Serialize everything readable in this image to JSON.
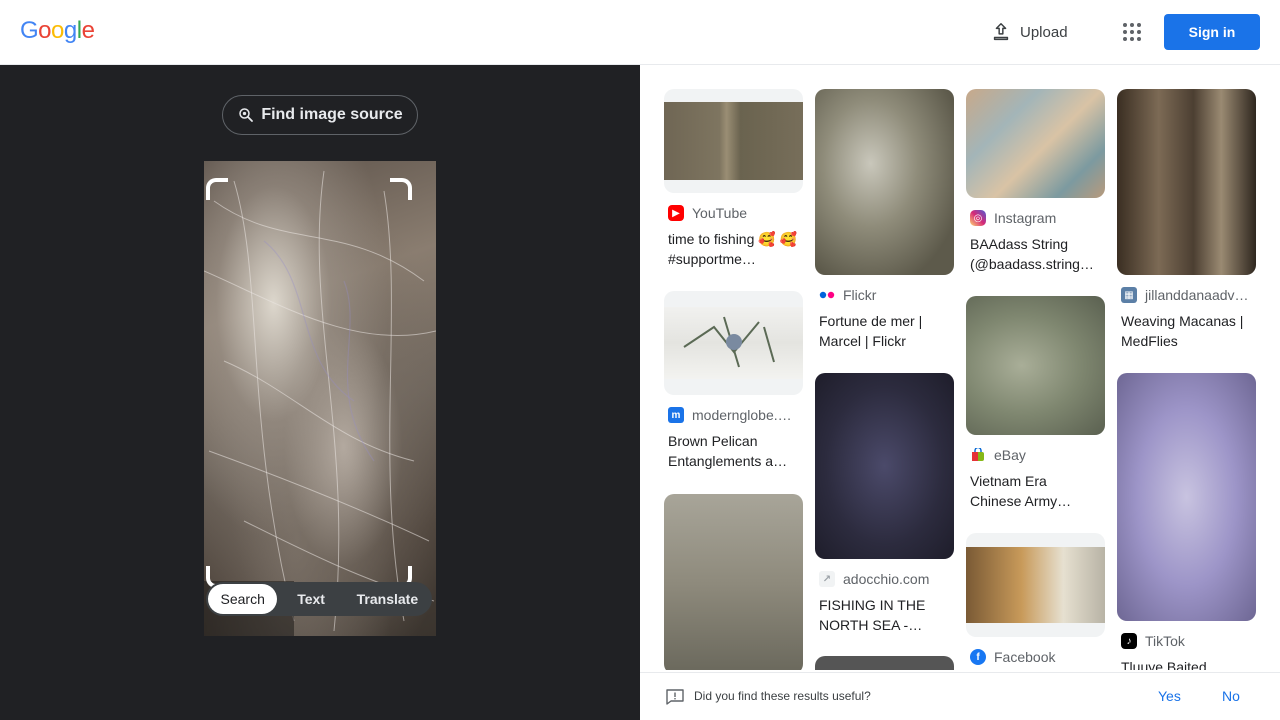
{
  "header": {
    "logo_letters": [
      "G",
      "o",
      "o",
      "g",
      "l",
      "e"
    ],
    "logo_colors": [
      "#4285F4",
      "#EA4335",
      "#FBBC05",
      "#4285F4",
      "#34A853",
      "#EA4335"
    ],
    "upload_label": "Upload",
    "signin_label": "Sign in",
    "accent_color": "#1a73e8"
  },
  "left": {
    "find_source_label": "Find image source",
    "modes": [
      "Search",
      "Text",
      "Translate"
    ],
    "active_mode": "Search"
  },
  "results": [
    {
      "source": "YouTube",
      "source_icon": "youtube-icon",
      "icon_color": "#ff0000",
      "title": "time to fishing 🥰 🥰 #supportme…"
    },
    {
      "source": "Flickr",
      "source_icon": "flickr-icon",
      "icon_color": "#0063dc",
      "title": "Fortune de mer | Marcel | Flickr"
    },
    {
      "source": "Instagram",
      "source_icon": "instagram-icon",
      "icon_color": "#d6249f",
      "title": "BAAdass String (@baadass.string…"
    },
    {
      "source": "jillanddanaadv…",
      "source_icon": "site-icon",
      "icon_color": "#5b7fa6",
      "title": "Weaving Macanas | MedFlies"
    },
    {
      "source": "modernglobe.…",
      "source_icon": "modernglobe-icon",
      "icon_color": "#1a73e8",
      "title": "Brown Pelican Entanglements a…"
    },
    {
      "source": "adocchio.com",
      "source_icon": "adocchio-icon",
      "icon_color": "#9aa0a6",
      "title": "FISHING IN THE NORTH SEA -…"
    },
    {
      "source": "eBay",
      "source_icon": "ebay-icon",
      "icon_color": "#e53238",
      "title": "Vietnam Era Chinese Army…"
    },
    {
      "source": "TikTok",
      "source_icon": "tiktok-icon",
      "icon_color": "#000000",
      "title": "Tluuye Baited"
    },
    {
      "source": "Facebook",
      "source_icon": "facebook-icon",
      "icon_color": "#1877f2",
      "title": ""
    }
  ],
  "feedback": {
    "question": "Did you find these results useful?",
    "yes": "Yes",
    "no": "No"
  }
}
